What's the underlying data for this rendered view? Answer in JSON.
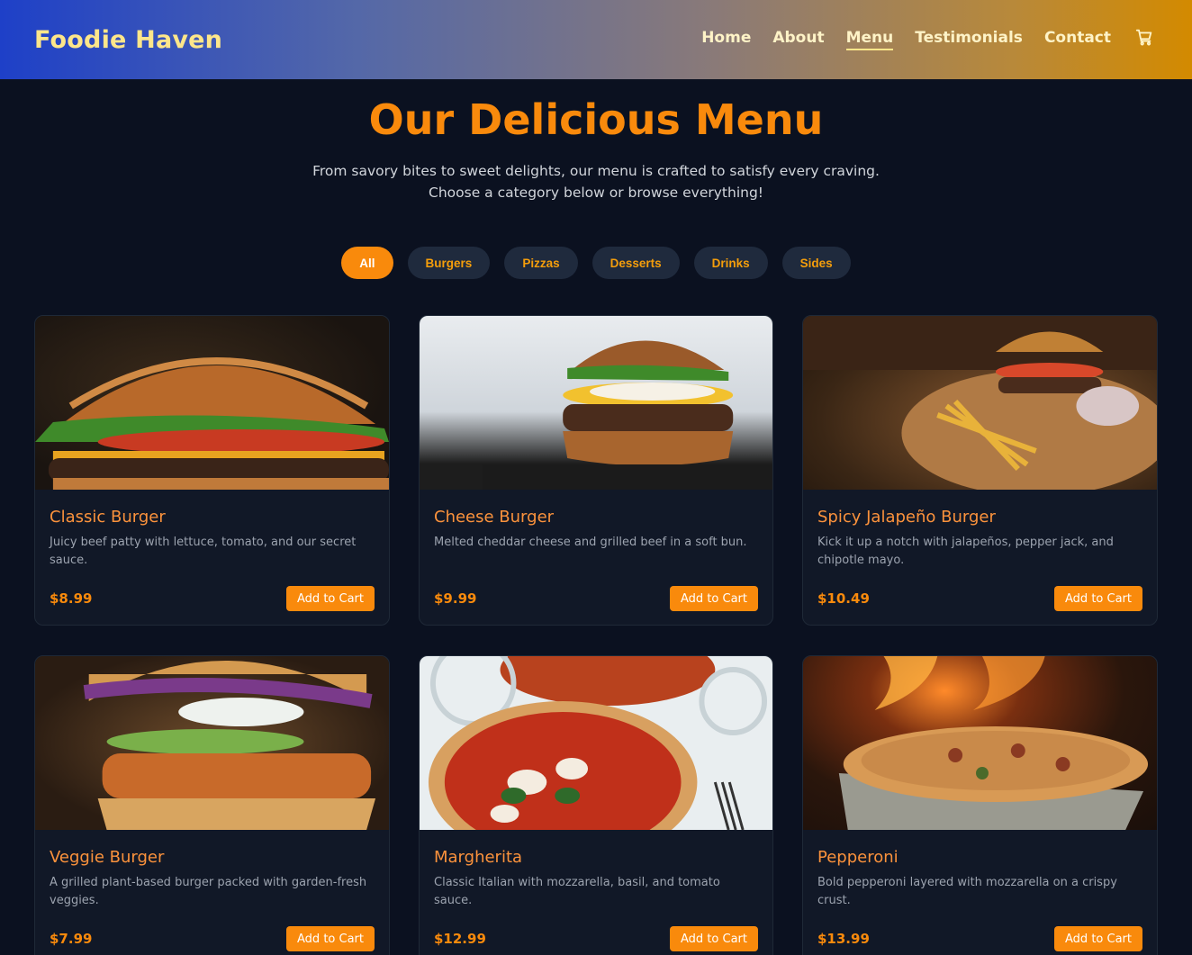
{
  "header": {
    "brand": "Foodie Haven",
    "nav": [
      {
        "label": "Home",
        "active": false
      },
      {
        "label": "About",
        "active": false
      },
      {
        "label": "Menu",
        "active": true
      },
      {
        "label": "Testimonials",
        "active": false
      },
      {
        "label": "Contact",
        "active": false
      }
    ],
    "cart_icon": "shopping-cart-icon"
  },
  "hero": {
    "title": "Our Delicious Menu",
    "subtitle": "From savory bites to sweet delights, our menu is crafted to satisfy every craving. Choose a category below or browse everything!"
  },
  "filters": [
    {
      "label": "All",
      "active": true
    },
    {
      "label": "Burgers",
      "active": false
    },
    {
      "label": "Pizzas",
      "active": false
    },
    {
      "label": "Desserts",
      "active": false
    },
    {
      "label": "Drinks",
      "active": false
    },
    {
      "label": "Sides",
      "active": false
    }
  ],
  "menu_items": [
    {
      "name": "Classic Burger",
      "description": "Juicy beef patty with lettuce, tomato, and our secret sauce.",
      "price": "$8.99",
      "button": "Add to Cart"
    },
    {
      "name": "Cheese Burger",
      "description": "Melted cheddar cheese and grilled beef in a soft bun.",
      "price": "$9.99",
      "button": "Add to Cart"
    },
    {
      "name": "Spicy Jalapeño Burger",
      "description": "Kick it up a notch with jalapeños, pepper jack, and chipotle mayo.",
      "price": "$10.49",
      "button": "Add to Cart"
    },
    {
      "name": "Veggie Burger",
      "description": "A grilled plant-based burger packed with garden-fresh veggies.",
      "price": "$7.99",
      "button": "Add to Cart"
    },
    {
      "name": "Margherita",
      "description": "Classic Italian with mozzarella, basil, and tomato sauce.",
      "price": "$12.99",
      "button": "Add to Cart"
    },
    {
      "name": "Pepperoni",
      "description": "Bold pepperoni layered with mozzarella on a crispy crust.",
      "price": "$13.99",
      "button": "Add to Cart"
    }
  ],
  "colors": {
    "accent": "#f98a0c",
    "background": "#0b1120",
    "card": "#111827",
    "brand": "#fde68a"
  }
}
